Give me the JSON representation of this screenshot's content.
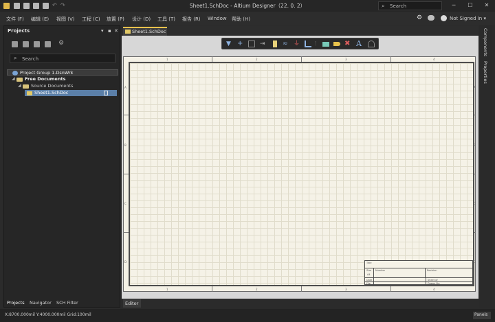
{
  "window": {
    "title": "Sheet1.SchDoc - Altium Designer（22. 0. 2）",
    "search_placeholder": "Search",
    "controls": [
      "─",
      "☐",
      "✕"
    ]
  },
  "menu": {
    "items": [
      "文件 (F)",
      "编辑 (E)",
      "视图 (V)",
      "工程 (C)",
      "放置 (P)",
      "设计 (D)",
      "工具 (T)",
      "报告 (R)",
      "Window",
      "帮助 (H)"
    ],
    "account": "Not Signed In",
    "account_caret": "▾"
  },
  "projects_panel": {
    "title": "Projects",
    "header_icons": [
      "▾",
      "▪",
      "✕"
    ],
    "search_placeholder": "Search",
    "tree": [
      {
        "label": "Project Group 1.DsnWrk",
        "level": 0,
        "kind": "group",
        "state": "hover"
      },
      {
        "label": "Free Documents",
        "level": 1,
        "kind": "folder",
        "state": "bold"
      },
      {
        "label": "Source Documents",
        "level": 2,
        "kind": "folder",
        "state": "normal"
      },
      {
        "label": "Sheet1.SchDoc",
        "level": 3,
        "kind": "file",
        "state": "selected"
      }
    ],
    "bottom_tabs": [
      "Projects",
      "Navigator",
      "SCH Filter"
    ]
  },
  "document": {
    "tab": "Sheet1.SchDoc",
    "editor_tab": "Editor",
    "zones_h": [
      "1",
      "2",
      "3",
      "4"
    ],
    "zones_v": [
      "A",
      "B",
      "C",
      "D"
    ],
    "title_block": {
      "title_label": "Title",
      "size_label": "Size",
      "number_label": "Number",
      "revision_label": "Revision",
      "size_value": "A4",
      "date_label": "Date",
      "file_label": "File",
      "sheet_label": "Sheet of",
      "drawn_label": "Drawn By:"
    }
  },
  "toolbar_icons": [
    "filter-icon",
    "cross-icon",
    "rect-select-icon",
    "move-icon",
    "align-icon",
    "wire-icon",
    "net-label-icon",
    "power-port-icon",
    "bus-icon",
    "component-icon",
    "port-icon",
    "no-erc-icon",
    "text-icon",
    "arc-icon"
  ],
  "right_dock": {
    "tabs": [
      "Components",
      "Properties"
    ]
  },
  "status": {
    "text": "X:8700.000mil Y:4000.000mil   Grid:100mil",
    "panels_label": "Panels"
  },
  "colors": {
    "accent": "#e8c24c",
    "selection": "#5b7fa8",
    "canvas": "#f5f2e7"
  }
}
